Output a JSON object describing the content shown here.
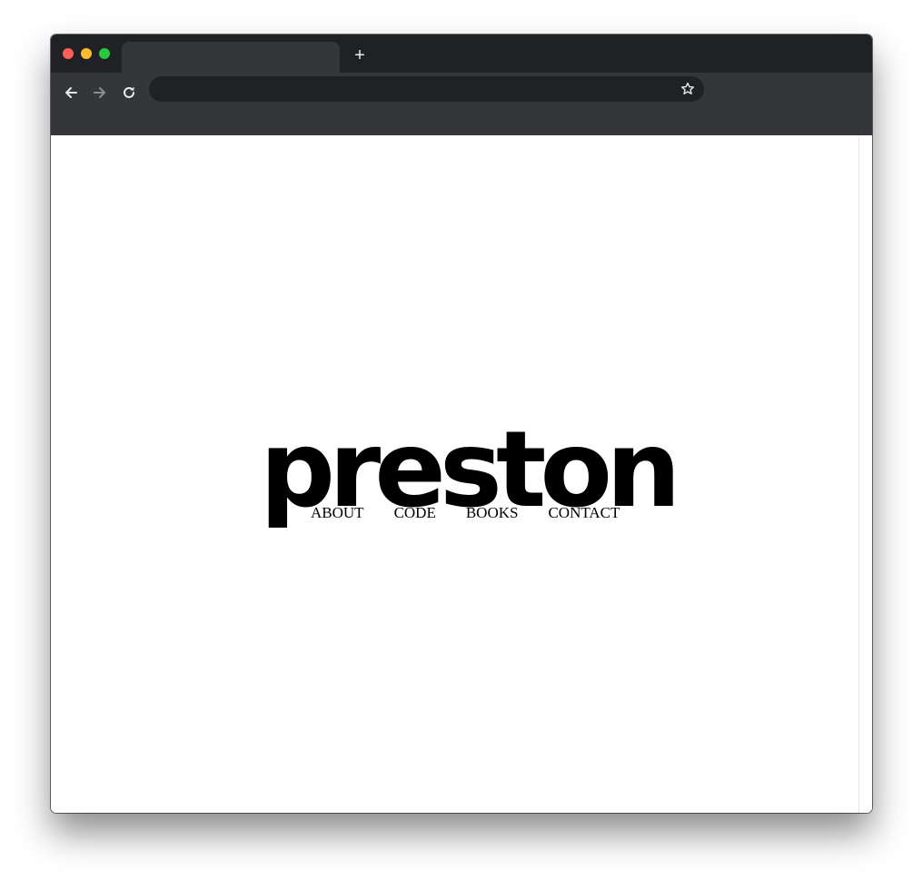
{
  "browser": {
    "tab": {
      "title": ""
    },
    "new_tab_symbol": "+",
    "omnibox": {
      "value": ""
    },
    "icons": {
      "back": "arrow-left-icon",
      "forward": "arrow-right-icon",
      "reload": "reload-icon",
      "bookmark": "star-icon"
    }
  },
  "page": {
    "logo": "preston",
    "nav": [
      "ABOUT",
      "CODE",
      "BOOKS",
      "CONTACT"
    ]
  },
  "colors": {
    "chrome_dark": "#202124",
    "chrome_toolbar": "#35363a",
    "page_background": "#ffffff",
    "text": "#000000"
  }
}
